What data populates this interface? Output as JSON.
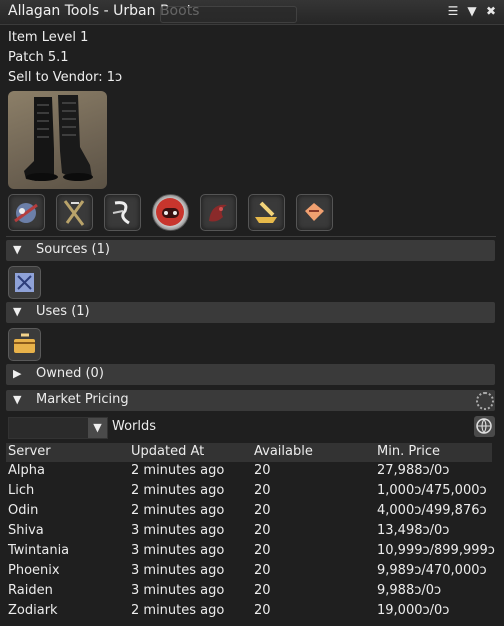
{
  "window": {
    "title": "Allagan Tools - Urban Boots",
    "menu_glyph": "☰",
    "collapse_glyph": "▼",
    "close_glyph": "✖"
  },
  "item": {
    "level": "Item Level 1",
    "patch": "Patch 5.1",
    "vendor": "Sell to Vendor: 1ɔ"
  },
  "sections": {
    "sources": {
      "label": "Sources (1)",
      "arrow": "▼"
    },
    "uses": {
      "label": "Uses (1)",
      "arrow": "▼"
    },
    "owned": {
      "label": "Owned (0)",
      "arrow": "▶"
    },
    "market": {
      "label": "Market Pricing",
      "arrow": "▼"
    }
  },
  "market": {
    "worlds_label": "Worlds",
    "dropdown_glyph": "▼",
    "columns": [
      "Server",
      "Updated At",
      "Available",
      "Min. Price"
    ],
    "rows": [
      {
        "server": "Alpha",
        "updated": "2 minutes ago",
        "available": "20",
        "price": "27,988ɔ/0ɔ"
      },
      {
        "server": "Lich",
        "updated": "2 minutes ago",
        "available": "20",
        "price": "1,000ɔ/475,000ɔ"
      },
      {
        "server": "Odin",
        "updated": "2 minutes ago",
        "available": "20",
        "price": "4,000ɔ/499,876ɔ"
      },
      {
        "server": "Shiva",
        "updated": "3 minutes ago",
        "available": "20",
        "price": "13,498ɔ/0ɔ"
      },
      {
        "server": "Twintania",
        "updated": "3 minutes ago",
        "available": "20",
        "price": "10,999ɔ/899,999ɔ"
      },
      {
        "server": "Phoenix",
        "updated": "3 minutes ago",
        "available": "20",
        "price": "9,989ɔ/470,000ɔ"
      },
      {
        "server": "Raiden",
        "updated": "3 minutes ago",
        "available": "20",
        "price": "9,988ɔ/0ɔ"
      },
      {
        "server": "Zodiark",
        "updated": "2 minutes ago",
        "available": "20",
        "price": "19,000ɔ/0ɔ"
      }
    ]
  },
  "icons": {
    "action_icons": [
      "mog-station-icon",
      "gardening-icon",
      "crafting-icon",
      "gamepad-icon",
      "dragon-icon",
      "hammer-anvil-icon",
      "hammer-box-icon"
    ],
    "source_icon": "gc-seal-icon",
    "uses_icon": "desynth-box-icon"
  }
}
